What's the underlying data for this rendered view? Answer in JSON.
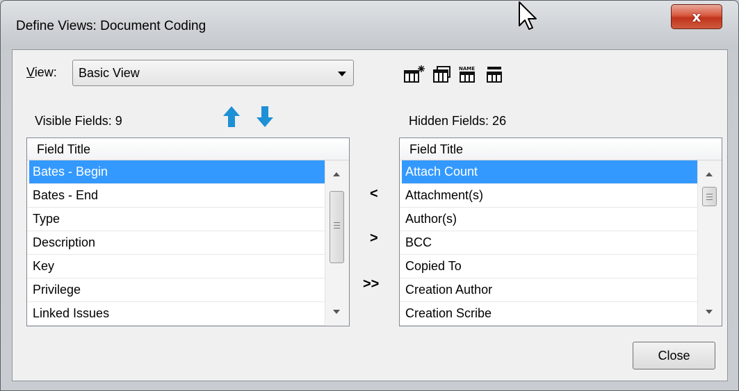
{
  "window": {
    "title": "Define Views: Document Coding",
    "close_glyph": "x"
  },
  "view": {
    "label": "View:",
    "mnemonic": "V",
    "label_rest": "iew:",
    "selected": "Basic View"
  },
  "toolbar": {
    "icons": [
      "new-view-icon",
      "copy-view-icon",
      "rename-view-icon",
      "delete-view-icon"
    ]
  },
  "visible": {
    "label": "Visible Fields: 9",
    "header": "Field Title",
    "rows": [
      "Bates - Begin",
      "Bates - End",
      "Type",
      "Description",
      "Key",
      "Privilege",
      "Linked Issues"
    ]
  },
  "hidden": {
    "label": "Hidden Fields: 26",
    "header": "Field Title",
    "rows": [
      "Attach Count",
      "Attachment(s)",
      "Author(s)",
      "BCC",
      "Copied To",
      "Creation Author",
      "Creation Scribe"
    ]
  },
  "transfer": {
    "left": "<",
    "right": ">",
    "all_right": ">>"
  },
  "buttons": {
    "close": "Close"
  },
  "colors": {
    "selection": "#3399ff",
    "move_arrows": "#1e90d6",
    "close_button": "#c0341c"
  }
}
